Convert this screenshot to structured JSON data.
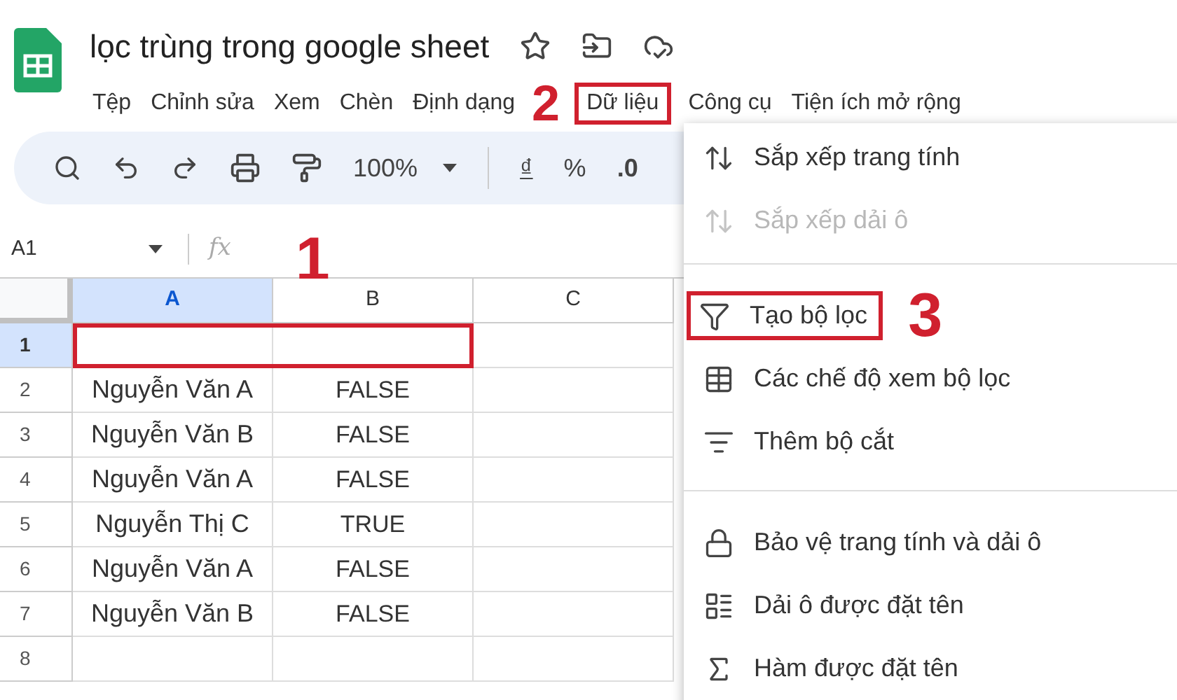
{
  "document": {
    "title": "lọc trùng trong google sheet"
  },
  "menu_bar": [
    {
      "label": "Tệp",
      "highlighted": false
    },
    {
      "label": "Chỉnh sửa",
      "highlighted": false
    },
    {
      "label": "Xem",
      "highlighted": false
    },
    {
      "label": "Chèn",
      "highlighted": false
    },
    {
      "label": "Định dạng",
      "highlighted": false
    },
    {
      "label": "Dữ liệu",
      "highlighted": true,
      "step": "2"
    },
    {
      "label": "Công cụ",
      "highlighted": false
    },
    {
      "label": "Tiện ích mở rộng",
      "highlighted": false
    }
  ],
  "toolbar": {
    "zoom": "100%",
    "currency": "₫",
    "percent": "%",
    "decimal": ".0"
  },
  "formula_bar": {
    "cell_ref": "A1",
    "fx": "fx",
    "step": "1"
  },
  "grid": {
    "columns": [
      {
        "label": "A",
        "selected": true
      },
      {
        "label": "B",
        "selected": false
      },
      {
        "label": "C",
        "selected": false
      }
    ],
    "rows": [
      {
        "label": "1",
        "selected": true,
        "highlighted": true,
        "cells": [
          "",
          ""
        ]
      },
      {
        "label": "2",
        "selected": false,
        "highlighted": false,
        "cells": [
          "Nguyễn Văn A",
          "FALSE"
        ]
      },
      {
        "label": "3",
        "selected": false,
        "highlighted": false,
        "cells": [
          "Nguyễn Văn B",
          "FALSE"
        ]
      },
      {
        "label": "4",
        "selected": false,
        "highlighted": false,
        "cells": [
          "Nguyễn Văn A",
          "FALSE"
        ]
      },
      {
        "label": "5",
        "selected": false,
        "highlighted": false,
        "cells": [
          "Nguyễn Thị C",
          "TRUE"
        ]
      },
      {
        "label": "6",
        "selected": false,
        "highlighted": false,
        "cells": [
          "Nguyễn Văn A",
          "FALSE"
        ]
      },
      {
        "label": "7",
        "selected": false,
        "highlighted": false,
        "cells": [
          "Nguyễn Văn B",
          "FALSE"
        ]
      },
      {
        "label": "8",
        "selected": false,
        "highlighted": false,
        "cells": [
          "",
          ""
        ]
      }
    ]
  },
  "data_menu": {
    "groups": [
      [
        {
          "kind": "sort",
          "label": "Sắp xếp trang tính",
          "disabled": false,
          "highlighted": false
        },
        {
          "kind": "sort",
          "label": "Sắp xếp dải ô",
          "disabled": true,
          "highlighted": false
        }
      ],
      [
        {
          "kind": "filter",
          "label": "Tạo bộ lọc",
          "disabled": false,
          "highlighted": true,
          "step": "3"
        },
        {
          "kind": "filter-views",
          "label": "Các chế độ xem bộ lọc",
          "disabled": false,
          "highlighted": false
        },
        {
          "kind": "slicer",
          "label": "Thêm bộ cắt",
          "disabled": false,
          "highlighted": false
        }
      ],
      [
        {
          "kind": "lock",
          "label": "Bảo vệ trang tính và dải ô",
          "disabled": false,
          "highlighted": false
        },
        {
          "kind": "named-range",
          "label": "Dải ô được đặt tên",
          "disabled": false,
          "highlighted": false
        },
        {
          "kind": "function",
          "label": "Hàm được đặt tên",
          "disabled": false,
          "highlighted": false
        }
      ]
    ]
  }
}
